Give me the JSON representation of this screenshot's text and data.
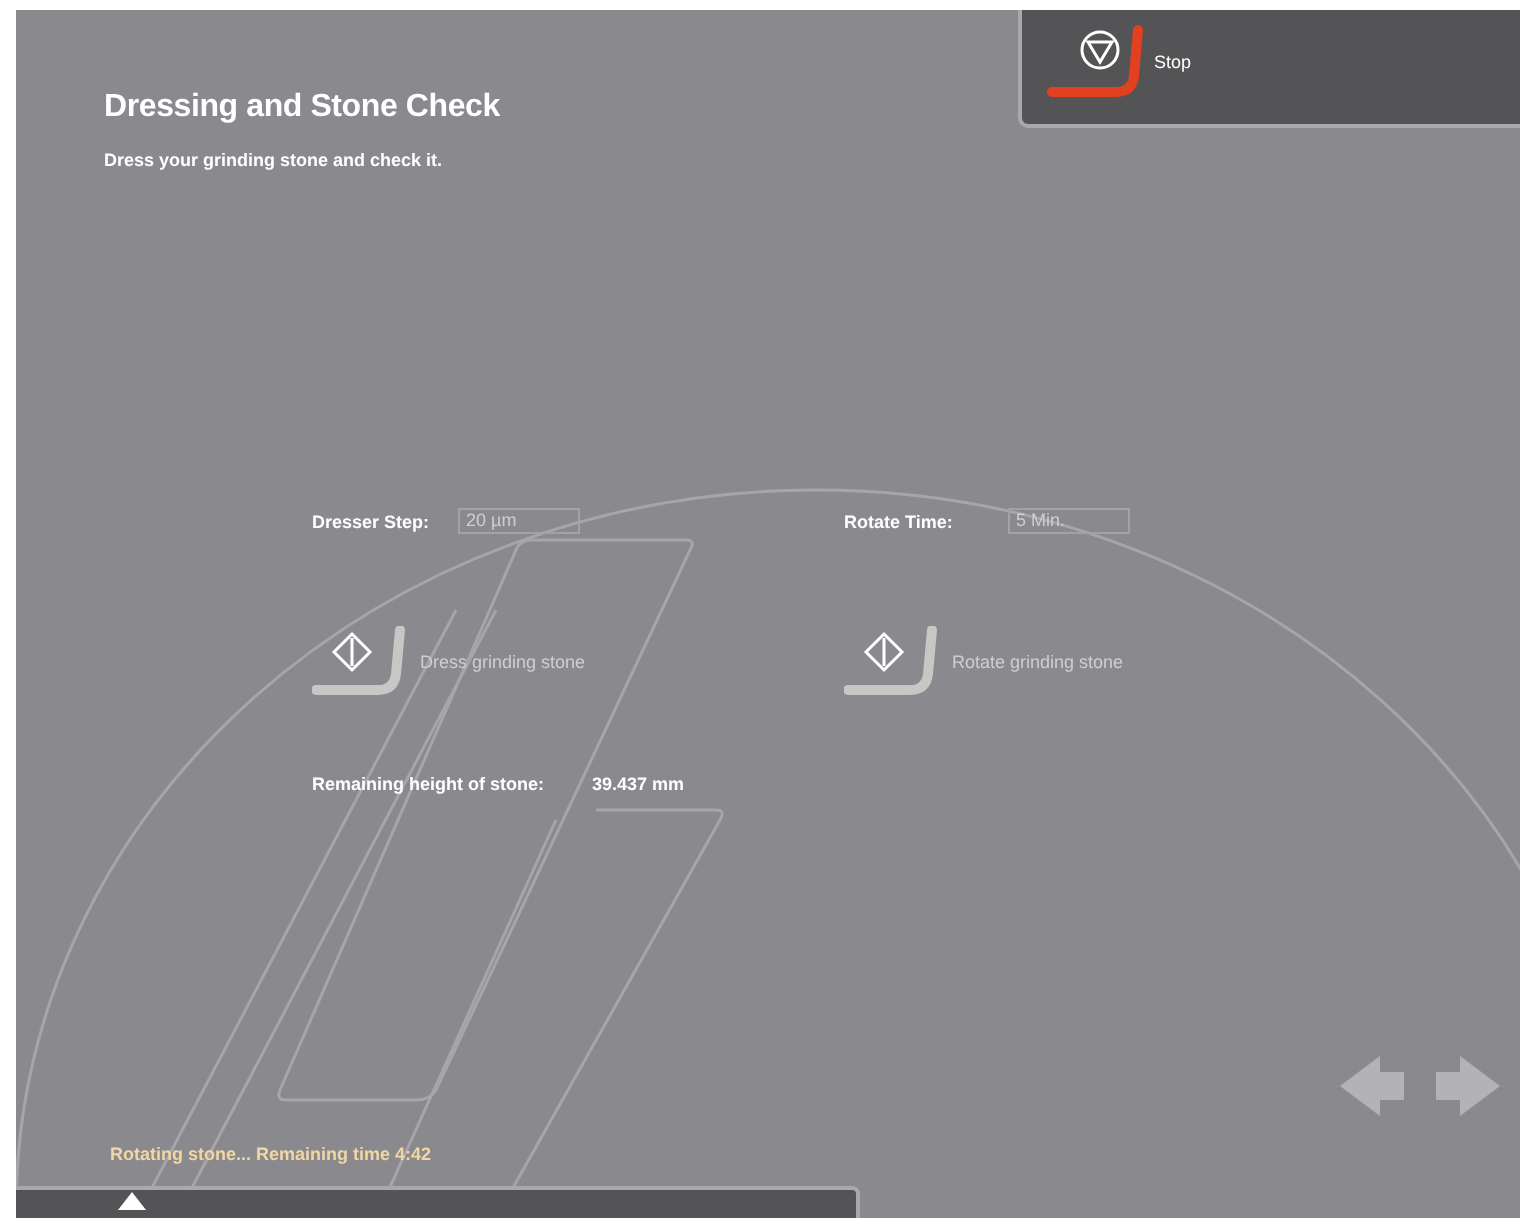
{
  "header": {
    "title": "Dressing and Stone Check",
    "subtitle": "Dress your grinding stone and check it."
  },
  "stop_button": {
    "label": "Stop",
    "disabled": false
  },
  "fields": [
    {
      "label": "Dresser Step:",
      "value": "20 µm",
      "disabled": true
    },
    {
      "label": "Rotate Time:",
      "value": "5 Min.",
      "disabled": true
    }
  ],
  "actions": [
    {
      "label": "Dress grinding stone",
      "disabled": true
    },
    {
      "label": "Rotate grinding stone",
      "disabled": true
    }
  ],
  "remaining": {
    "label": "Remaining height of stone:",
    "value": "39.437 mm"
  },
  "nav": {
    "back_disabled": true,
    "forward_disabled": true
  },
  "status": "Rotating stone... Remaining time 4:42"
}
